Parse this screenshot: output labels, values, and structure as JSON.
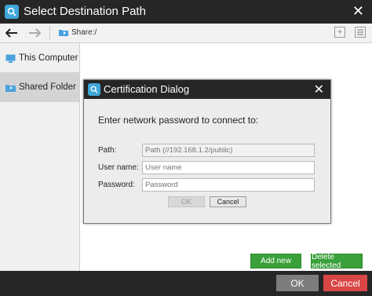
{
  "window": {
    "title": "Select Destination Path",
    "close_glyph": "✕"
  },
  "toolbar": {
    "back_icon": "arrow-left-icon",
    "forward_icon": "arrow-right-icon",
    "path": "Share:/"
  },
  "sidebar": {
    "items": [
      {
        "label": "This Computer",
        "icon": "monitor-icon",
        "selected": false
      },
      {
        "label": "Shared Folder",
        "icon": "shared-folder-icon",
        "selected": true
      }
    ]
  },
  "actions": {
    "add_new": "Add new",
    "delete_selected": "Delete selected"
  },
  "footer": {
    "ok": "OK",
    "cancel": "Cancel"
  },
  "dialog": {
    "title": "Certification Dialog",
    "close_glyph": "✕",
    "message": "Enter network password to connect to:",
    "path_label": "Path:",
    "path_placeholder": "Path (//192.168.1.2/public)",
    "username_label": "User name:",
    "username_placeholder": "User name",
    "password_label": "Password:",
    "password_placeholder": "Password",
    "ok": "OK",
    "cancel": "Cancel"
  },
  "colors": {
    "titlebar": "#262626",
    "accent_green": "#3aa13a",
    "cancel_red": "#d94646",
    "icon_blue": "#3fa7d9"
  }
}
